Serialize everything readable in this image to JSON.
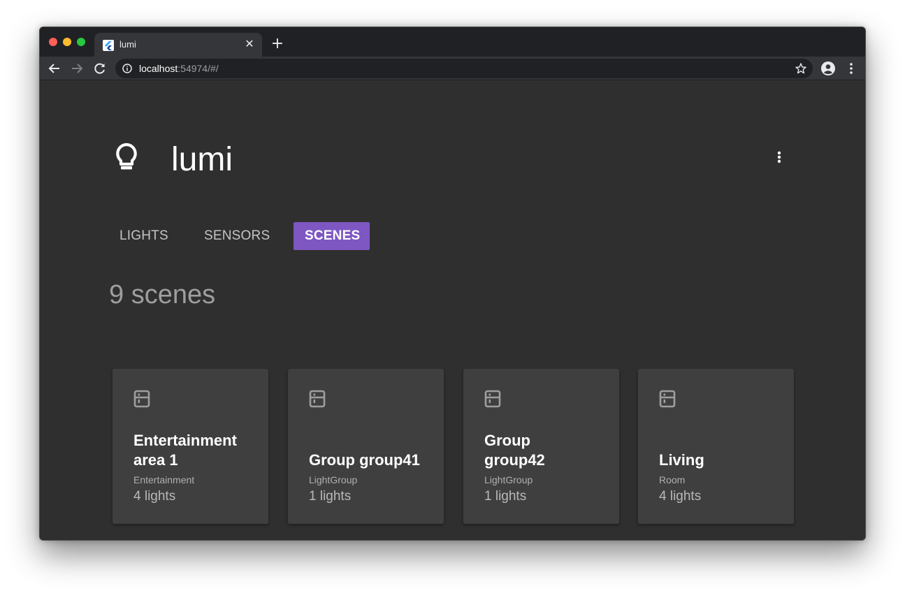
{
  "browser": {
    "tab_title": "lumi",
    "url_host": "localhost",
    "url_rest": ":54974/#/"
  },
  "app": {
    "title": "lumi",
    "accent": "#7e57c2",
    "tabs": [
      {
        "label": "LIGHTS",
        "active": false
      },
      {
        "label": "SENSORS",
        "active": false
      },
      {
        "label": "SCENES",
        "active": true
      }
    ],
    "count_label": "9 scenes",
    "cards": [
      {
        "name": "Entertainment area 1",
        "type": "Entertainment",
        "lights": "4 lights",
        "icon": "scene-icon"
      },
      {
        "name": "Group group41",
        "type": "LightGroup",
        "lights": "1 lights",
        "icon": "scene-icon"
      },
      {
        "name": "Group group42",
        "type": "LightGroup",
        "lights": "1 lights",
        "icon": "scene-icon"
      },
      {
        "name": "Living",
        "type": "Room",
        "lights": "4 lights",
        "icon": "scene-icon"
      }
    ]
  }
}
